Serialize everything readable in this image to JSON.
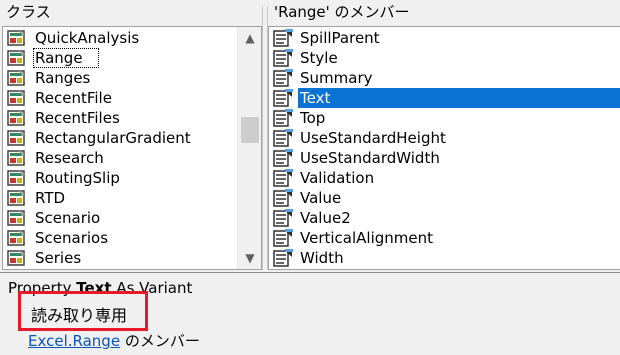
{
  "classes_pane": {
    "header": "クラス",
    "items": [
      {
        "label": "QuickAnalysis"
      },
      {
        "label": "Range",
        "focused": true
      },
      {
        "label": "Ranges"
      },
      {
        "label": "RecentFile"
      },
      {
        "label": "RecentFiles"
      },
      {
        "label": "RectangularGradient"
      },
      {
        "label": "Research"
      },
      {
        "label": "RoutingSlip"
      },
      {
        "label": "RTD"
      },
      {
        "label": "Scenario"
      },
      {
        "label": "Scenarios"
      },
      {
        "label": "Series"
      }
    ],
    "icon": "class-object-icon"
  },
  "members_pane": {
    "header": "'Range' のメンバー",
    "items": [
      {
        "label": "SpillParent"
      },
      {
        "label": "Style"
      },
      {
        "label": "Summary"
      },
      {
        "label": "Text",
        "selected": true
      },
      {
        "label": "Top"
      },
      {
        "label": "UseStandardHeight"
      },
      {
        "label": "UseStandardWidth"
      },
      {
        "label": "Validation"
      },
      {
        "label": "Value"
      },
      {
        "label": "Value2"
      },
      {
        "label": "VerticalAlignment"
      },
      {
        "label": "Width"
      }
    ],
    "icon": "property-icon"
  },
  "details": {
    "declaration_prefix": "Property",
    "declaration_name": "Text",
    "declaration_suffix": "As Variant",
    "readonly_label": "読み取り専用",
    "member_of_link": "Excel.Range",
    "member_of_suffix": " のメンバー"
  },
  "colors": {
    "selection": "#0a72d2",
    "highlight_box": "#e6192b",
    "link": "#0a54b8"
  }
}
